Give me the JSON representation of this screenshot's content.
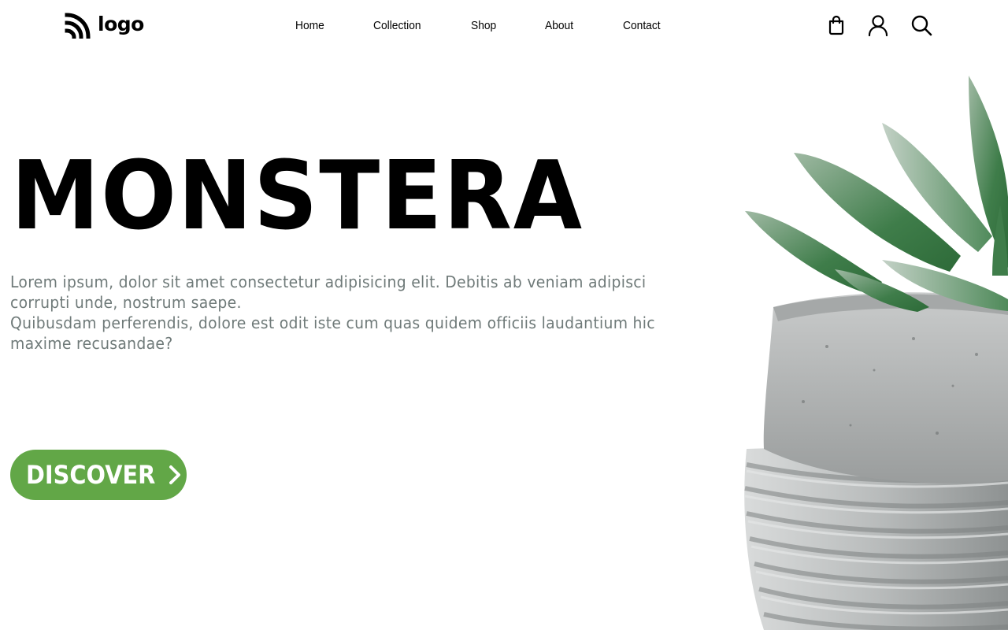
{
  "header": {
    "logo_text": "logo",
    "logo_icon": "logo-icon",
    "nav": [
      {
        "label": "Home"
      },
      {
        "label": "Collection"
      },
      {
        "label": "Shop"
      },
      {
        "label": "About"
      },
      {
        "label": "Contact"
      }
    ],
    "icons": [
      "shopping-bag-icon",
      "user-icon",
      "search-icon"
    ]
  },
  "hero": {
    "title": "MONSTERA",
    "description_line1": "Lorem ipsum, dolor sit amet consectetur adipisicing elit. Debitis ab veniam adipisci corrupti unde, nostrum saepe.",
    "description_line2": "Quibusdam perferendis, dolore est odit iste cum quas quidem officiis laudantium hic maxime recusandae?",
    "cta_label": "DISCOVER",
    "cta_icon": "chevron-right-icon"
  },
  "colors": {
    "accent": "#62a747",
    "text": "#000000",
    "muted_text": "#6f7a79",
    "background": "#ffffff"
  }
}
